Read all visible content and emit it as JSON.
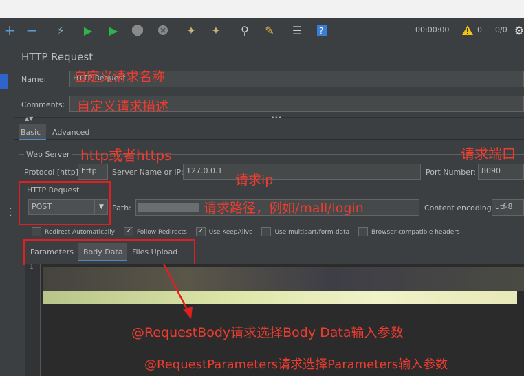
{
  "toolbar": {
    "timer": "00:00:00",
    "warning_count": "0",
    "thread_ratio": "0/0"
  },
  "panel": {
    "title": "HTTP Request",
    "name_label": "Name:",
    "name_value": "HTTP Request",
    "comments_label": "Comments:"
  },
  "tabs": {
    "basic": "Basic",
    "advanced": "Advanced"
  },
  "web_server": {
    "legend": "Web Server",
    "protocol_label": "Protocol [http]:",
    "protocol_value": "http",
    "server_label": "Server Name or IP:",
    "server_value": "127.0.0.1",
    "port_label": "Port Number:",
    "port_value": "8090"
  },
  "http_request": {
    "legend": "HTTP Request",
    "method": "POST",
    "path_label": "Path:",
    "encoding_label": "Content encoding:",
    "encoding_value": "utf-8"
  },
  "checkboxes": [
    {
      "label": "Redirect Automatically",
      "checked": false
    },
    {
      "label": "Follow Redirects",
      "checked": true
    },
    {
      "label": "Use KeepAlive",
      "checked": true
    },
    {
      "label": "Use multipart/form-data",
      "checked": false
    },
    {
      "label": "Browser-compatible headers",
      "checked": false
    }
  ],
  "body_tabs": {
    "parameters": "Parameters",
    "body_data": "Body Data",
    "files_upload": "Files Upload"
  },
  "annotations": {
    "name": "自定义请求名称",
    "comments": "自定义请求描述",
    "protocol": "http或者https",
    "port": "请求端口",
    "ip": "请求ip",
    "path": "请求路径，例如/mall/login",
    "request_body": "@RequestBody请求选择Body Data输入参数",
    "request_params": "@RequestParameters请求选择Parameters输入参数"
  },
  "colors": {
    "annotation": "#ee3c30",
    "highlight_box": "#e02020",
    "background": "#3c3f41"
  }
}
